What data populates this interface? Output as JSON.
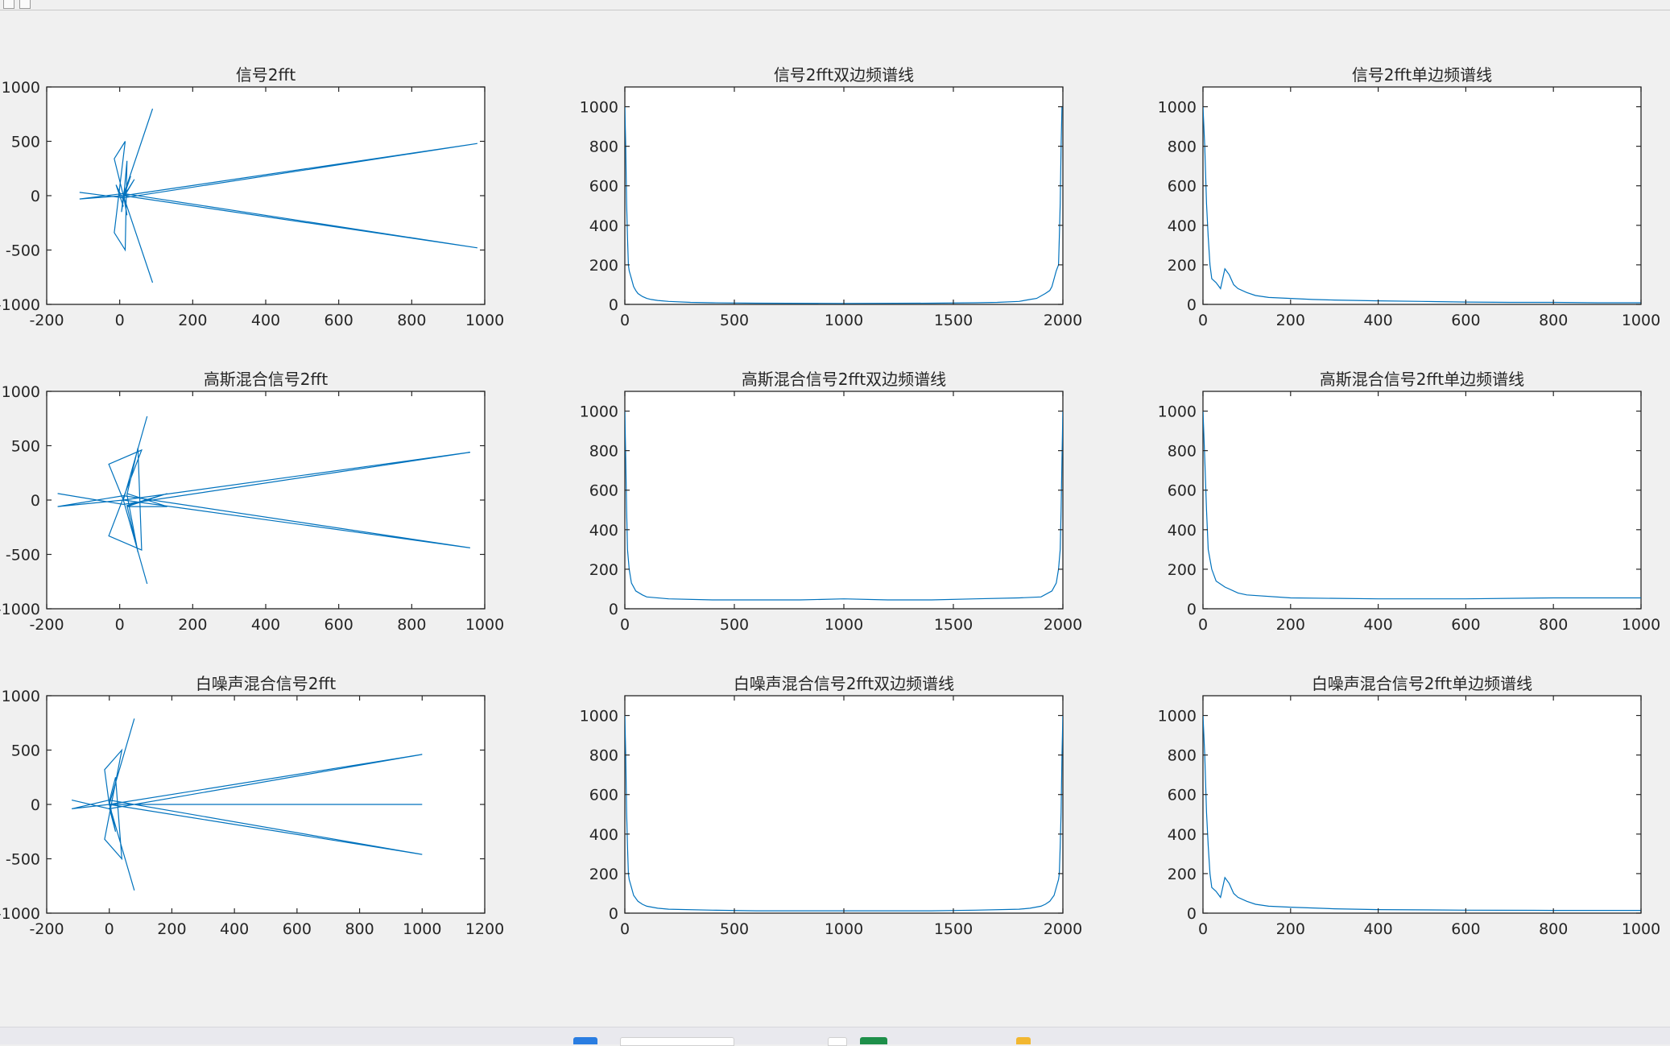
{
  "colors": {
    "line": "#0072bd",
    "axis": "#262626",
    "background": "#f0f0f0"
  },
  "chart_data": [
    {
      "type": "line",
      "title": "信号2fft",
      "xlim": [
        -200,
        1000
      ],
      "ylim": [
        -1000,
        1000
      ],
      "xticks": [
        -200,
        0,
        200,
        400,
        600,
        800,
        1000
      ],
      "yticks": [
        -1000,
        -500,
        0,
        500,
        1000
      ],
      "series": [
        {
          "x": [
            -110,
            10,
            980,
            10,
            -110,
            10,
            980,
            10,
            90,
            10,
            90,
            10,
            -15,
            15,
            -15,
            15,
            20,
            12,
            30,
            10,
            40,
            12,
            20,
            10,
            5,
            12,
            15,
            8,
            12,
            10,
            -10,
            10,
            0,
            8
          ],
          "y": [
            30,
            -20,
            480,
            0,
            -30,
            20,
            -480,
            0,
            800,
            0,
            -800,
            0,
            340,
            500,
            -340,
            -500,
            320,
            30,
            180,
            -20,
            150,
            0,
            -180,
            10,
            -150,
            0,
            60,
            -60,
            40,
            -40,
            100,
            -100,
            0,
            0
          ]
        }
      ]
    },
    {
      "type": "line",
      "title": "信号2fft双边频谱线",
      "xlim": [
        0,
        2000
      ],
      "ylim": [
        0,
        1100
      ],
      "xticks": [
        0,
        500,
        1000,
        1500,
        2000
      ],
      "yticks": [
        0,
        200,
        400,
        600,
        800,
        1000
      ],
      "series": [
        {
          "x": [
            0,
            4,
            8,
            12,
            16,
            20,
            30,
            40,
            50,
            60,
            80,
            100,
            120,
            150,
            200,
            300,
            400,
            600,
            1000,
            1400,
            1600,
            1700,
            1800,
            1850,
            1880,
            1920,
            1940,
            1950,
            1960,
            1970,
            1980,
            1984,
            1988,
            1992,
            1996,
            2000
          ],
          "y": [
            1000,
            800,
            510,
            340,
            200,
            170,
            130,
            90,
            70,
            55,
            40,
            30,
            25,
            20,
            15,
            10,
            8,
            6,
            5,
            6,
            8,
            10,
            15,
            25,
            30,
            55,
            70,
            90,
            130,
            170,
            200,
            340,
            510,
            800,
            1000,
            1000
          ]
        }
      ]
    },
    {
      "type": "line",
      "title": "信号2fft单边频谱线",
      "xlim": [
        0,
        1000
      ],
      "ylim": [
        0,
        1100
      ],
      "xticks": [
        0,
        200,
        400,
        600,
        800,
        1000
      ],
      "yticks": [
        0,
        200,
        400,
        600,
        800,
        1000
      ],
      "series": [
        {
          "x": [
            0,
            4,
            8,
            12,
            16,
            20,
            30,
            40,
            50,
            60,
            70,
            80,
            100,
            120,
            150,
            200,
            250,
            300,
            400,
            500,
            600,
            700,
            800,
            900,
            1000
          ],
          "y": [
            1000,
            800,
            510,
            340,
            200,
            130,
            110,
            80,
            180,
            150,
            100,
            80,
            60,
            45,
            35,
            30,
            25,
            22,
            18,
            15,
            12,
            10,
            10,
            8,
            8
          ]
        }
      ]
    },
    {
      "type": "line",
      "title": "高斯混合信号2fft",
      "xlim": [
        -200,
        1000
      ],
      "ylim": [
        -1000,
        1000
      ],
      "xticks": [
        -200,
        0,
        200,
        400,
        600,
        800,
        1000
      ],
      "yticks": [
        -1000,
        -500,
        0,
        500,
        1000
      ],
      "series": [
        {
          "x": [
            -170,
            10,
            960,
            10,
            -170,
            10,
            960,
            10,
            75,
            10,
            75,
            10,
            -30,
            60,
            -30,
            60,
            50,
            20,
            50,
            20,
            130,
            20,
            130,
            20
          ],
          "y": [
            60,
            -40,
            440,
            0,
            -60,
            40,
            -440,
            0,
            770,
            0,
            -770,
            0,
            330,
            460,
            -330,
            -460,
            480,
            50,
            -480,
            -50,
            60,
            -60,
            -60,
            60
          ]
        }
      ]
    },
    {
      "type": "line",
      "title": "高斯混合信号2fft双边频谱线",
      "xlim": [
        0,
        2000
      ],
      "ylim": [
        0,
        1100
      ],
      "xticks": [
        0,
        500,
        1000,
        1500,
        2000
      ],
      "yticks": [
        0,
        200,
        400,
        600,
        800,
        1000
      ],
      "series": [
        {
          "x": [
            0,
            4,
            8,
            12,
            20,
            30,
            50,
            80,
            100,
            200,
            400,
            600,
            800,
            1000,
            1200,
            1400,
            1600,
            1800,
            1900,
            1950,
            1970,
            1980,
            1988,
            1992,
            1996,
            2000
          ],
          "y": [
            1000,
            760,
            500,
            300,
            200,
            130,
            90,
            70,
            60,
            50,
            45,
            45,
            45,
            50,
            45,
            45,
            50,
            55,
            60,
            90,
            130,
            200,
            300,
            500,
            760,
            1000
          ]
        }
      ]
    },
    {
      "type": "line",
      "title": "高斯混合信号2fft单边频谱线",
      "xlim": [
        0,
        1000
      ],
      "ylim": [
        0,
        1100
      ],
      "xticks": [
        0,
        200,
        400,
        600,
        800,
        1000
      ],
      "yticks": [
        0,
        200,
        400,
        600,
        800,
        1000
      ],
      "series": [
        {
          "x": [
            0,
            4,
            8,
            12,
            20,
            30,
            50,
            80,
            100,
            200,
            400,
            600,
            800,
            1000
          ],
          "y": [
            1000,
            760,
            500,
            300,
            200,
            140,
            110,
            80,
            70,
            55,
            50,
            50,
            55,
            55
          ]
        }
      ]
    },
    {
      "type": "line",
      "title": "白噪声混合信号2fft",
      "xlim": [
        -200,
        1200
      ],
      "ylim": [
        -1000,
        1000
      ],
      "xticks": [
        -200,
        0,
        200,
        400,
        600,
        800,
        1000,
        1200
      ],
      "yticks": [
        -1000,
        -500,
        0,
        500,
        1000
      ],
      "series": [
        {
          "x": [
            -120,
            0,
            1000,
            0,
            -120,
            0,
            1000,
            0,
            1000,
            0,
            80,
            0,
            80,
            0,
            -15,
            40,
            -15,
            40,
            20,
            0,
            20,
            0
          ],
          "y": [
            40,
            -40,
            460,
            0,
            -40,
            40,
            -460,
            0,
            0,
            0,
            790,
            0,
            -790,
            0,
            320,
            500,
            -320,
            -500,
            250,
            30,
            -250,
            -30
          ]
        }
      ]
    },
    {
      "type": "line",
      "title": "白噪声混合信号2fft双边频谱线",
      "xlim": [
        0,
        2000
      ],
      "ylim": [
        0,
        1100
      ],
      "xticks": [
        0,
        500,
        1000,
        1500,
        2000
      ],
      "yticks": [
        0,
        200,
        400,
        600,
        800,
        1000
      ],
      "series": [
        {
          "x": [
            0,
            4,
            8,
            12,
            16,
            20,
            30,
            40,
            60,
            80,
            100,
            150,
            200,
            400,
            600,
            1000,
            1400,
            1600,
            1800,
            1850,
            1900,
            1920,
            1940,
            1960,
            1970,
            1980,
            1984,
            1988,
            1992,
            1996,
            2000
          ],
          "y": [
            1000,
            800,
            510,
            340,
            200,
            170,
            130,
            90,
            60,
            45,
            35,
            25,
            20,
            15,
            12,
            12,
            12,
            15,
            20,
            25,
            35,
            45,
            60,
            90,
            130,
            170,
            200,
            340,
            510,
            800,
            1000
          ]
        }
      ]
    },
    {
      "type": "line",
      "title": "白噪声混合信号2fft单边频谱线",
      "xlim": [
        0,
        1000
      ],
      "ylim": [
        0,
        1100
      ],
      "xticks": [
        0,
        200,
        400,
        600,
        800,
        1000
      ],
      "yticks": [
        0,
        200,
        400,
        600,
        800,
        1000
      ],
      "series": [
        {
          "x": [
            0,
            4,
            8,
            12,
            16,
            20,
            30,
            40,
            50,
            60,
            70,
            80,
            100,
            120,
            150,
            200,
            300,
            400,
            600,
            800,
            1000
          ],
          "y": [
            1000,
            800,
            510,
            340,
            200,
            130,
            110,
            80,
            180,
            150,
            100,
            80,
            60,
            45,
            35,
            30,
            22,
            18,
            15,
            14,
            14
          ]
        }
      ]
    }
  ]
}
